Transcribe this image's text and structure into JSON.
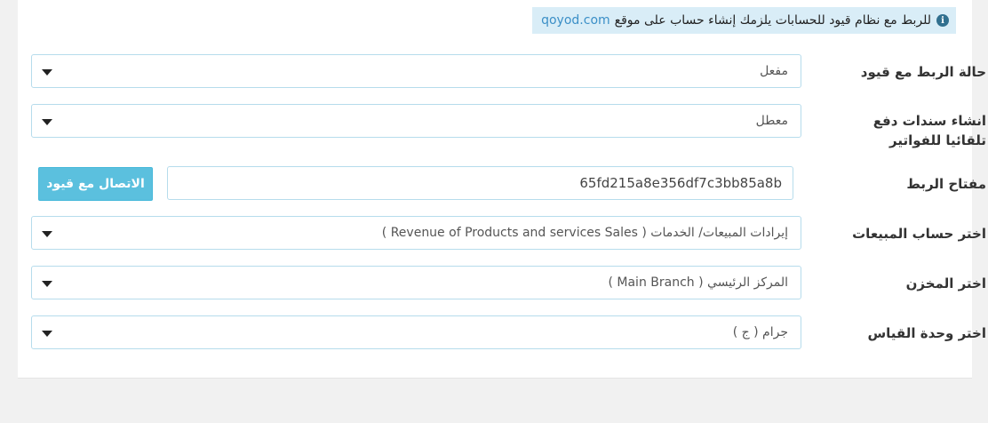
{
  "info": {
    "text": "للربط مع نظام قيود للحسابات يلزمك إنشاء حساب على موقع",
    "link": "qoyod.com"
  },
  "rows": {
    "link_status": {
      "label": "حالة الربط مع قيود",
      "value": "مفعل"
    },
    "auto_receipts": {
      "label": "انشاء سندات دفع تلقائيا للفواتير",
      "value": "معطل"
    },
    "api_key": {
      "label": "مفتاح الربط",
      "value": "65fd215a8e356df7c3bb85a8b",
      "button": "الاتصال مع قيود"
    },
    "sales_account": {
      "label": "اختر حساب المبيعات",
      "value": "إيرادات المبيعات/ الخدمات ( Revenue of Products and services Sales )"
    },
    "warehouse": {
      "label": "اختر المخزن",
      "value": "المركز الرئيسي ( Main Branch )"
    },
    "unit": {
      "label": "اختر وحدة القياس",
      "value": "جرام ( ج )"
    }
  },
  "colors": {
    "info_bg": "#d9edf7",
    "accent_button": "#5bc0de",
    "input_border": "#b6dcec"
  }
}
